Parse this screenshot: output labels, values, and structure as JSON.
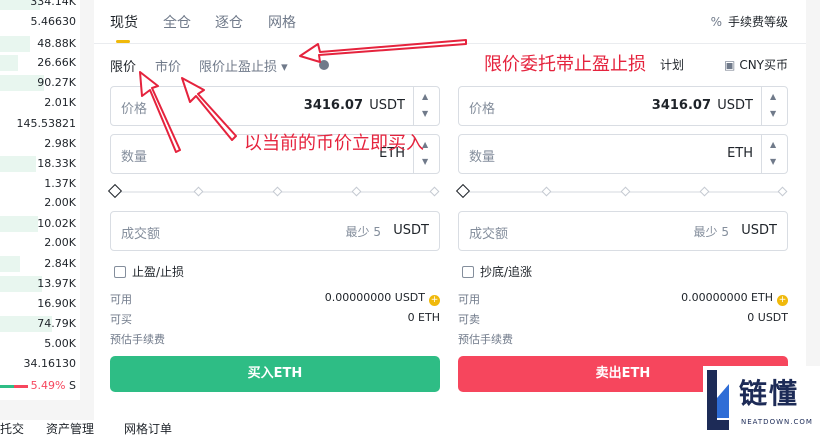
{
  "orderbook": {
    "rows": [
      "334.14K",
      "5.46630",
      "48.88K",
      "26.66K",
      "90.27K",
      "2.01K",
      "145.53821",
      "2.98K",
      "18.33K",
      "1.37K",
      "2.00K",
      "10.02K",
      "2.00K",
      "2.84K",
      "13.97K",
      "16.90K",
      "74.79K",
      "5.00K",
      "34.16130"
    ],
    "footer_pct": "5.49%",
    "footer_suffix": "S"
  },
  "tabs": [
    "现货",
    "全仓",
    "逐仓",
    "网格"
  ],
  "fee_level": "手续费等级",
  "order_types": {
    "limit": "限价",
    "market": "市价",
    "tp_sl": "限价止盈止损 ▾",
    "plan": "计划",
    "cny_buy": "CNY买币"
  },
  "buy": {
    "price_label": "价格",
    "price_value": "3416.07",
    "price_unit": "USDT",
    "qty_label": "数量",
    "qty_unit": "ETH",
    "total_label": "成交额",
    "total_hint": "最少 5",
    "total_unit": "USDT",
    "check_label": "止盈/止损",
    "available_label": "可用",
    "available_value": "0.00000000 USDT",
    "can_label": "可买",
    "can_value": "0 ETH",
    "fee_label": "预估手续费",
    "button": "买入ETH"
  },
  "sell": {
    "price_label": "价格",
    "price_value": "3416.07",
    "price_unit": "USDT",
    "qty_label": "数量",
    "qty_unit": "ETH",
    "total_label": "成交额",
    "total_hint": "最少 5",
    "total_unit": "USDT",
    "check_label": "抄底/追涨",
    "available_label": "可用",
    "available_value": "0.00000000 ETH",
    "can_label": "可卖",
    "can_value": "0 USDT",
    "fee_label": "预估手续费",
    "button": "卖出ETH"
  },
  "annotations": {
    "top": "限价委托带止盈止损",
    "middle": "以当前的币价立即买入"
  },
  "bottom_tabs": [
    "托交",
    "资产管理",
    "网格订单"
  ],
  "watermark": {
    "name": "链懂",
    "domain": "NEATDOWN.COM"
  },
  "colors": {
    "buy": "#2ebd85",
    "sell": "#f6465d",
    "accent": "#f0b90b",
    "annotation": "#e5233d"
  }
}
